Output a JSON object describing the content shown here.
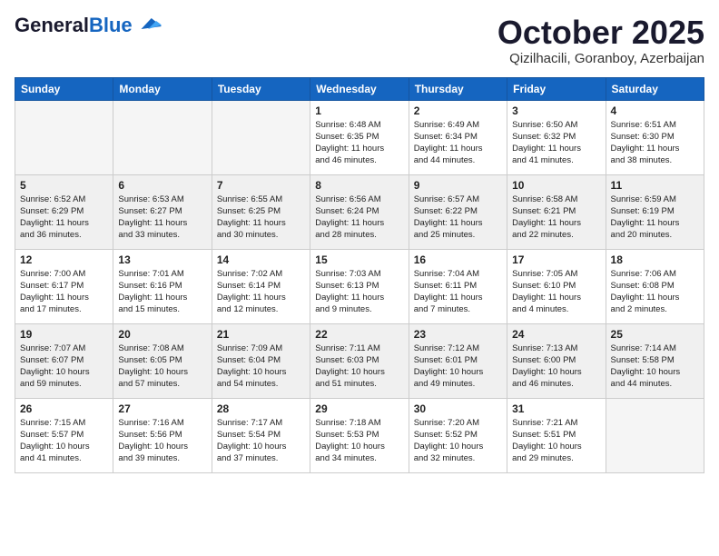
{
  "header": {
    "logo_general": "General",
    "logo_blue": "Blue",
    "month_title": "October 2025",
    "location": "Qizilhacili, Goranboy, Azerbaijan"
  },
  "days_of_week": [
    "Sunday",
    "Monday",
    "Tuesday",
    "Wednesday",
    "Thursday",
    "Friday",
    "Saturday"
  ],
  "weeks": [
    [
      {
        "day": "",
        "info": "",
        "empty": true
      },
      {
        "day": "",
        "info": "",
        "empty": true
      },
      {
        "day": "",
        "info": "",
        "empty": true
      },
      {
        "day": "1",
        "info": "Sunrise: 6:48 AM\nSunset: 6:35 PM\nDaylight: 11 hours\nand 46 minutes."
      },
      {
        "day": "2",
        "info": "Sunrise: 6:49 AM\nSunset: 6:34 PM\nDaylight: 11 hours\nand 44 minutes."
      },
      {
        "day": "3",
        "info": "Sunrise: 6:50 AM\nSunset: 6:32 PM\nDaylight: 11 hours\nand 41 minutes."
      },
      {
        "day": "4",
        "info": "Sunrise: 6:51 AM\nSunset: 6:30 PM\nDaylight: 11 hours\nand 38 minutes."
      }
    ],
    [
      {
        "day": "5",
        "info": "Sunrise: 6:52 AM\nSunset: 6:29 PM\nDaylight: 11 hours\nand 36 minutes.",
        "shaded": true
      },
      {
        "day": "6",
        "info": "Sunrise: 6:53 AM\nSunset: 6:27 PM\nDaylight: 11 hours\nand 33 minutes.",
        "shaded": true
      },
      {
        "day": "7",
        "info": "Sunrise: 6:55 AM\nSunset: 6:25 PM\nDaylight: 11 hours\nand 30 minutes.",
        "shaded": true
      },
      {
        "day": "8",
        "info": "Sunrise: 6:56 AM\nSunset: 6:24 PM\nDaylight: 11 hours\nand 28 minutes.",
        "shaded": true
      },
      {
        "day": "9",
        "info": "Sunrise: 6:57 AM\nSunset: 6:22 PM\nDaylight: 11 hours\nand 25 minutes.",
        "shaded": true
      },
      {
        "day": "10",
        "info": "Sunrise: 6:58 AM\nSunset: 6:21 PM\nDaylight: 11 hours\nand 22 minutes.",
        "shaded": true
      },
      {
        "day": "11",
        "info": "Sunrise: 6:59 AM\nSunset: 6:19 PM\nDaylight: 11 hours\nand 20 minutes.",
        "shaded": true
      }
    ],
    [
      {
        "day": "12",
        "info": "Sunrise: 7:00 AM\nSunset: 6:17 PM\nDaylight: 11 hours\nand 17 minutes."
      },
      {
        "day": "13",
        "info": "Sunrise: 7:01 AM\nSunset: 6:16 PM\nDaylight: 11 hours\nand 15 minutes."
      },
      {
        "day": "14",
        "info": "Sunrise: 7:02 AM\nSunset: 6:14 PM\nDaylight: 11 hours\nand 12 minutes."
      },
      {
        "day": "15",
        "info": "Sunrise: 7:03 AM\nSunset: 6:13 PM\nDaylight: 11 hours\nand 9 minutes."
      },
      {
        "day": "16",
        "info": "Sunrise: 7:04 AM\nSunset: 6:11 PM\nDaylight: 11 hours\nand 7 minutes."
      },
      {
        "day": "17",
        "info": "Sunrise: 7:05 AM\nSunset: 6:10 PM\nDaylight: 11 hours\nand 4 minutes."
      },
      {
        "day": "18",
        "info": "Sunrise: 7:06 AM\nSunset: 6:08 PM\nDaylight: 11 hours\nand 2 minutes."
      }
    ],
    [
      {
        "day": "19",
        "info": "Sunrise: 7:07 AM\nSunset: 6:07 PM\nDaylight: 10 hours\nand 59 minutes.",
        "shaded": true
      },
      {
        "day": "20",
        "info": "Sunrise: 7:08 AM\nSunset: 6:05 PM\nDaylight: 10 hours\nand 57 minutes.",
        "shaded": true
      },
      {
        "day": "21",
        "info": "Sunrise: 7:09 AM\nSunset: 6:04 PM\nDaylight: 10 hours\nand 54 minutes.",
        "shaded": true
      },
      {
        "day": "22",
        "info": "Sunrise: 7:11 AM\nSunset: 6:03 PM\nDaylight: 10 hours\nand 51 minutes.",
        "shaded": true
      },
      {
        "day": "23",
        "info": "Sunrise: 7:12 AM\nSunset: 6:01 PM\nDaylight: 10 hours\nand 49 minutes.",
        "shaded": true
      },
      {
        "day": "24",
        "info": "Sunrise: 7:13 AM\nSunset: 6:00 PM\nDaylight: 10 hours\nand 46 minutes.",
        "shaded": true
      },
      {
        "day": "25",
        "info": "Sunrise: 7:14 AM\nSunset: 5:58 PM\nDaylight: 10 hours\nand 44 minutes.",
        "shaded": true
      }
    ],
    [
      {
        "day": "26",
        "info": "Sunrise: 7:15 AM\nSunset: 5:57 PM\nDaylight: 10 hours\nand 41 minutes."
      },
      {
        "day": "27",
        "info": "Sunrise: 7:16 AM\nSunset: 5:56 PM\nDaylight: 10 hours\nand 39 minutes."
      },
      {
        "day": "28",
        "info": "Sunrise: 7:17 AM\nSunset: 5:54 PM\nDaylight: 10 hours\nand 37 minutes."
      },
      {
        "day": "29",
        "info": "Sunrise: 7:18 AM\nSunset: 5:53 PM\nDaylight: 10 hours\nand 34 minutes."
      },
      {
        "day": "30",
        "info": "Sunrise: 7:20 AM\nSunset: 5:52 PM\nDaylight: 10 hours\nand 32 minutes."
      },
      {
        "day": "31",
        "info": "Sunrise: 7:21 AM\nSunset: 5:51 PM\nDaylight: 10 hours\nand 29 minutes."
      },
      {
        "day": "",
        "info": "",
        "empty": true
      }
    ]
  ]
}
